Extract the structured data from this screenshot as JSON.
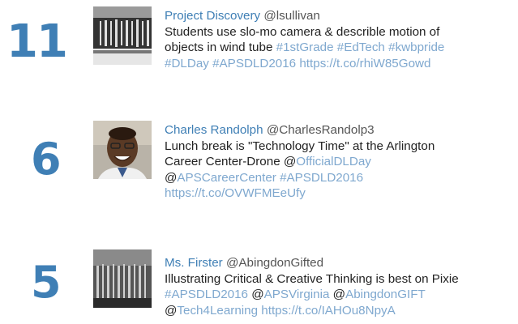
{
  "entries": [
    {
      "count": "11",
      "avatar_icon": "slow-motion-tube-photo",
      "name": "Project Discovery",
      "handle": "@lsullivan",
      "lines": [
        [
          {
            "t": "Students use slo-mo camera & describle motion of",
            "k": "text"
          }
        ],
        [
          {
            "t": "objects in wind tube ",
            "k": "text"
          },
          {
            "t": "#1stGrade",
            "k": "link"
          },
          {
            "t": " ",
            "k": "text"
          },
          {
            "t": "#EdTech",
            "k": "link"
          },
          {
            "t": " ",
            "k": "text"
          },
          {
            "t": "#kwbpride",
            "k": "link"
          }
        ],
        [
          {
            "t": "#DLDay",
            "k": "link"
          },
          {
            "t": " ",
            "k": "text"
          },
          {
            "t": "#APSDLD2016",
            "k": "link"
          },
          {
            "t": " ",
            "k": "text"
          },
          {
            "t": "https://t.co/rhiW85Gowd",
            "k": "link"
          }
        ]
      ]
    },
    {
      "count": "6",
      "avatar_icon": "smiling-man-portrait",
      "name": "Charles Randolph",
      "handle": "@CharlesRandolp3",
      "lines": [
        [
          {
            "t": "Lunch break is \"Technology Time\" at the Arlington",
            "k": "text"
          }
        ],
        [
          {
            "t": "Career Center-Drone @",
            "k": "text"
          },
          {
            "t": "OfficialDLDay",
            "k": "link"
          }
        ],
        [
          {
            "t": "@",
            "k": "text"
          },
          {
            "t": "APSCareerCenter",
            "k": "link"
          },
          {
            "t": " ",
            "k": "text"
          },
          {
            "t": "#APSDLD2016",
            "k": "link"
          }
        ],
        [
          {
            "t": "https://t.co/OVWFMEeUfy",
            "k": "link"
          }
        ]
      ]
    },
    {
      "count": "5",
      "avatar_icon": "striped-photo",
      "name": "Ms. Firster",
      "handle": "@AbingdonGifted",
      "lines": [
        [
          {
            "t": "Illustrating Critical & Creative Thinking is best on Pixie",
            "k": "text"
          }
        ],
        [
          {
            "t": "#APSDLD2016",
            "k": "link"
          },
          {
            "t": " @",
            "k": "text"
          },
          {
            "t": "APSVirginia",
            "k": "link"
          },
          {
            "t": " @",
            "k": "text"
          },
          {
            "t": "AbingdonGIFT",
            "k": "link"
          }
        ],
        [
          {
            "t": "@",
            "k": "text"
          },
          {
            "t": "Tech4Learning",
            "k": "link"
          },
          {
            "t": " ",
            "k": "text"
          },
          {
            "t": "https://t.co/IAHOu8NpyA",
            "k": "link"
          }
        ]
      ]
    }
  ]
}
